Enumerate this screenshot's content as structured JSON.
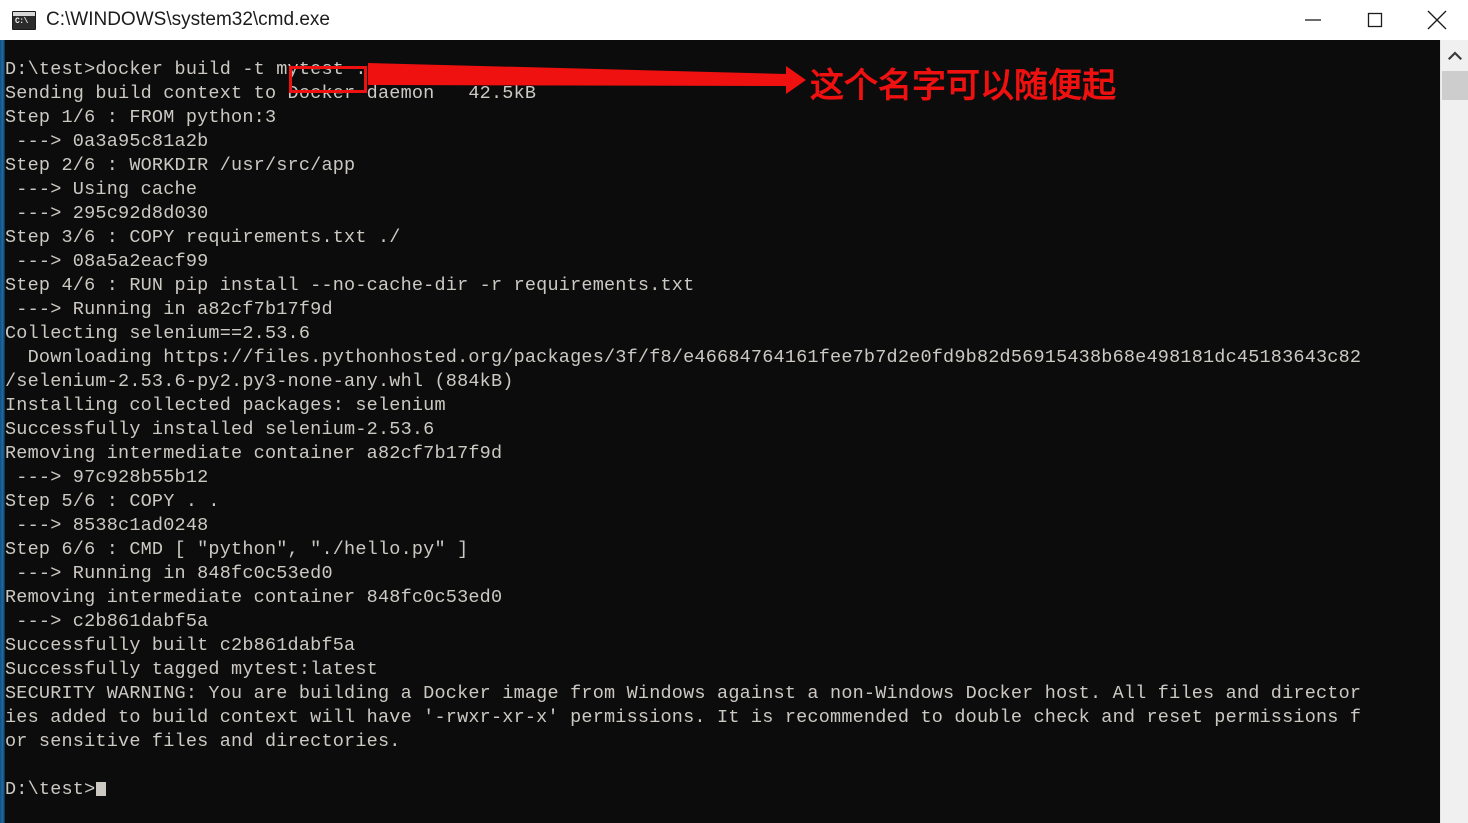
{
  "window": {
    "title": "C:\\WINDOWS\\system32\\cmd.exe",
    "icon": "cmd-console-icon",
    "icon_glyph": "C:\\",
    "background_color": "#0c0c0c",
    "text_color": "#ccc9c3",
    "accent_color": "#ef1010",
    "controls": {
      "minimize": "minimize-button",
      "maximize": "maximize-button",
      "close": "close-button"
    }
  },
  "console": {
    "lines": [
      "D:\\test>docker build -t mytest .",
      "Sending build context to Docker daemon   42.5kB",
      "Step 1/6 : FROM python:3",
      " ---> 0a3a95c81a2b",
      "Step 2/6 : WORKDIR /usr/src/app",
      " ---> Using cache",
      " ---> 295c92d8d030",
      "Step 3/6 : COPY requirements.txt ./",
      " ---> 08a5a2eacf99",
      "Step 4/6 : RUN pip install --no-cache-dir -r requirements.txt",
      " ---> Running in a82cf7b17f9d",
      "Collecting selenium==2.53.6",
      "  Downloading https://files.pythonhosted.org/packages/3f/f8/e46684764161fee7b7d2e0fd9b82d56915438b68e498181dc45183643c82",
      "/selenium-2.53.6-py2.py3-none-any.whl (884kB)",
      "Installing collected packages: selenium",
      "Successfully installed selenium-2.53.6",
      "Removing intermediate container a82cf7b17f9d",
      " ---> 97c928b55b12",
      "Step 5/6 : COPY . .",
      " ---> 8538c1ad0248",
      "Step 6/6 : CMD [ \"python\", \"./hello.py\" ]",
      " ---> Running in 848fc0c53ed0",
      "Removing intermediate container 848fc0c53ed0",
      " ---> c2b861dabf5a",
      "Successfully built c2b861dabf5a",
      "Successfully tagged mytest:latest",
      "SECURITY WARNING: You are building a Docker image from Windows against a non-Windows Docker host. All files and director",
      "ies added to build context will have '-rwxr-xr-x' permissions. It is recommended to double check and reset permissions f",
      "or sensitive files and directories.",
      "",
      "D:\\test>"
    ],
    "prompt": "D:\\test>",
    "cursor": "block-cursor"
  },
  "annotations": {
    "highlight_target": "mytest",
    "note_text": "这个名字可以随便起",
    "arrow": "red-arrow-right",
    "color": "#ef1010"
  },
  "scrollbar": {
    "up_arrow": "scroll-up-arrow",
    "thumb": "scroll-thumb",
    "track": "scroll-track"
  }
}
